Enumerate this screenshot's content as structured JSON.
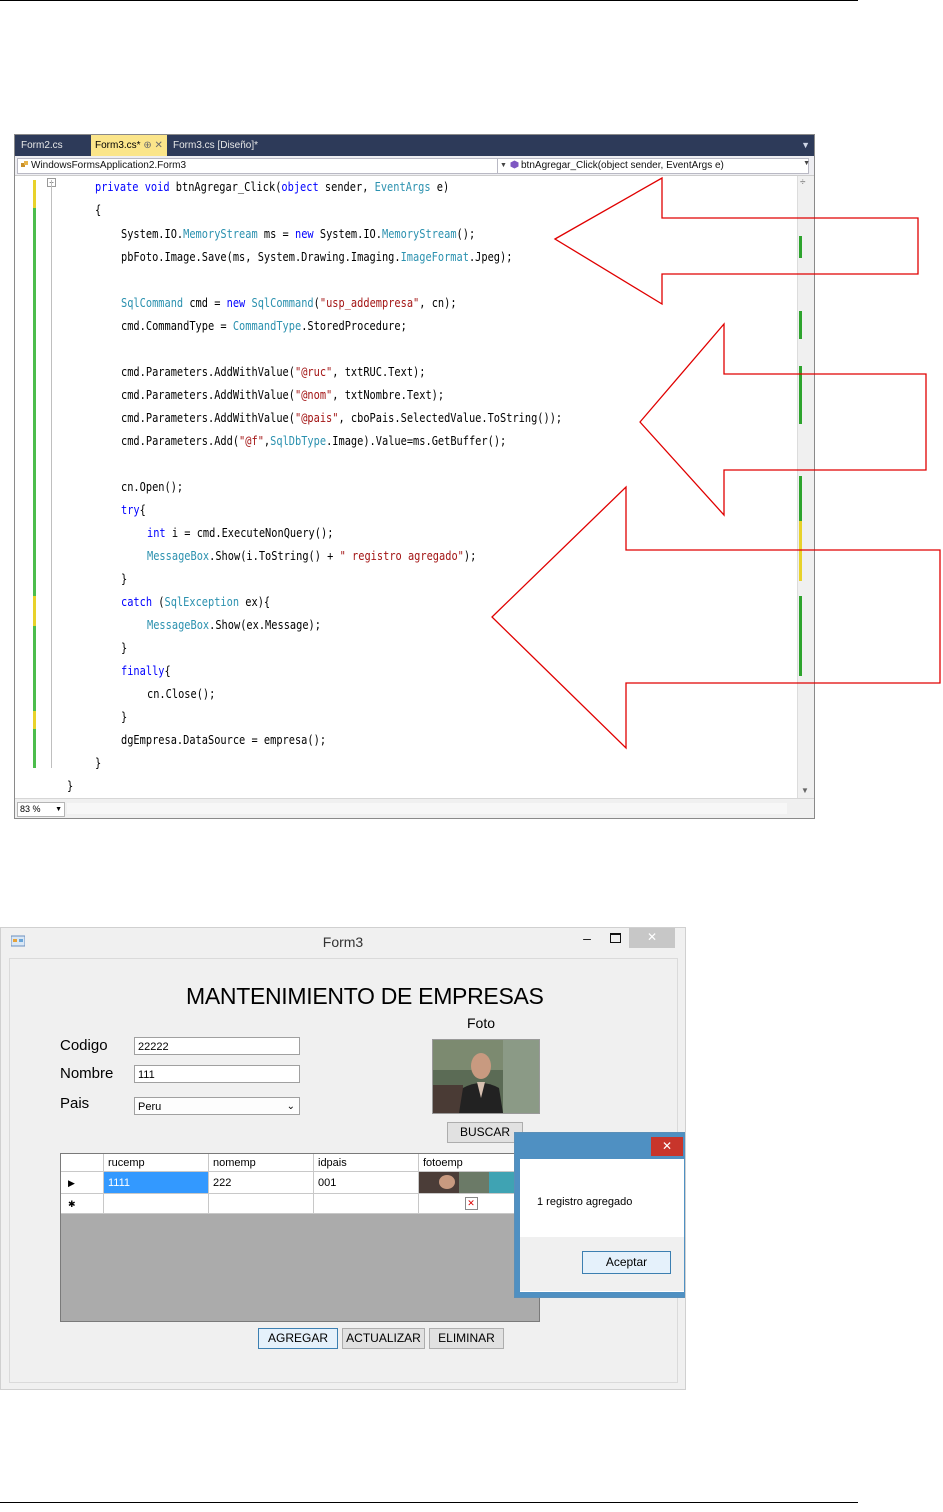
{
  "ide": {
    "tabs": [
      "Form2.cs",
      "Form3.cs*",
      "Form3.cs [Diseño]*"
    ],
    "tab_pin": "⊕ ✕",
    "nav_class": "WindowsFormsApplication2.Form3",
    "nav_method": "btnAgregar_Click(object sender, EventArgs e)",
    "zoom": "83 %",
    "code_lines": [
      "private void btnAgregar_Click(object sender, EventArgs e)",
      "{",
      "System.IO.MemoryStream ms = new System.IO.MemoryStream();",
      "pbFoto.Image.Save(ms, System.Drawing.Imaging.ImageFormat.Jpeg);",
      "",
      "SqlCommand cmd = new SqlCommand(\"usp_addempresa\", cn);",
      "cmd.CommandType = CommandType.StoredProcedure;",
      "",
      "cmd.Parameters.AddWithValue(\"@ruc\", txtRUC.Text);",
      "cmd.Parameters.AddWithValue(\"@nom\", txtNombre.Text);",
      "cmd.Parameters.AddWithValue(\"@pais\", cboPais.SelectedValue.ToString());",
      "cmd.Parameters.Add(\"@f\",SqlDbType.Image).Value=ms.GetBuffer();",
      "",
      "cn.Open();",
      "try{",
      "int i = cmd.ExecuteNonQuery();",
      "MessageBox.Show(i.ToString() + \" registro agregado\");",
      "}",
      "catch (SqlException ex){",
      "MessageBox.Show(ex.Message);",
      "}",
      "finally{",
      "cn.Close();",
      "}",
      "dgEmpresa.DataSource = empresa();",
      "}",
      "}"
    ]
  },
  "form": {
    "title": "Form3",
    "heading": "MANTENIMIENTO DE EMPRESAS",
    "foto_label": "Foto",
    "labels": {
      "codigo": "Codigo",
      "nombre": "Nombre",
      "pais": "Pais"
    },
    "fields": {
      "codigo": "22222",
      "nombre": "111",
      "pais": "Peru"
    },
    "buscar": "BUSCAR",
    "grid": {
      "columns": [
        "rucemp",
        "nomemp",
        "idpais",
        "fotoemp"
      ],
      "rows": [
        [
          "1111",
          "222",
          "001",
          ""
        ]
      ]
    },
    "buttons": {
      "agregar": "AGREGAR",
      "actualizar": "ACTUALIZAR",
      "eliminar": "ELIMINAR"
    },
    "dialog": {
      "message": "1 registro agregado",
      "ok": "Aceptar"
    }
  },
  "colors": {
    "arrow": "#e00000",
    "dialog_frame": "#4f90c2",
    "selected_cell": "#3399ff"
  }
}
